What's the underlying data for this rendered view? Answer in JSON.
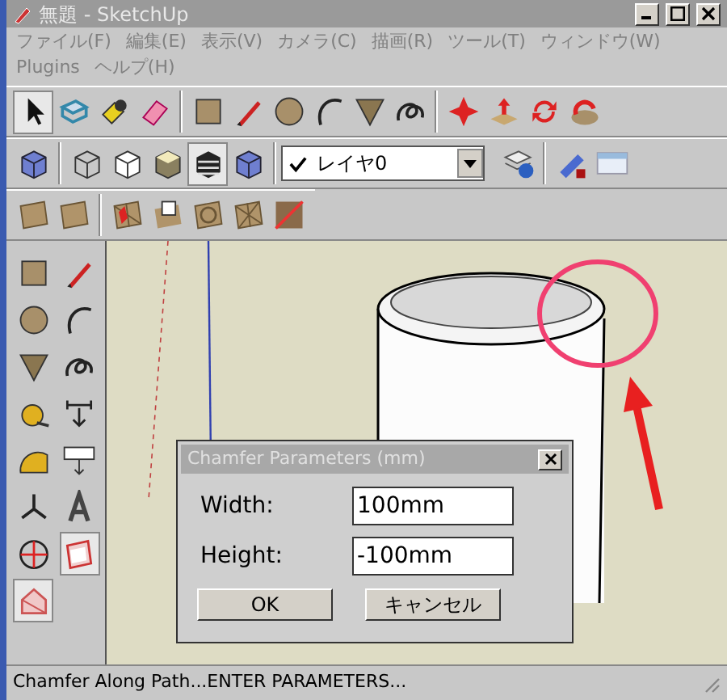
{
  "window": {
    "title": "無題 - SketchUp"
  },
  "menu": [
    "ファイル(F)",
    "編集(E)",
    "表示(V)",
    "カメラ(C)",
    "描画(R)",
    "ツール(T)",
    "ウィンドウ(W)",
    "Plugins",
    "ヘルプ(H)"
  ],
  "layer_dropdown": {
    "value": "レイヤ0"
  },
  "dialog": {
    "title": "Chamfer Parameters (mm)",
    "fields": [
      {
        "label": "Width:",
        "value": "100mm"
      },
      {
        "label": "Height:",
        "value": "-100mm"
      }
    ],
    "buttons": [
      "OK",
      "キャンセル"
    ]
  },
  "status_bar": "Chamfer Along Path...ENTER PARAMETERS..."
}
